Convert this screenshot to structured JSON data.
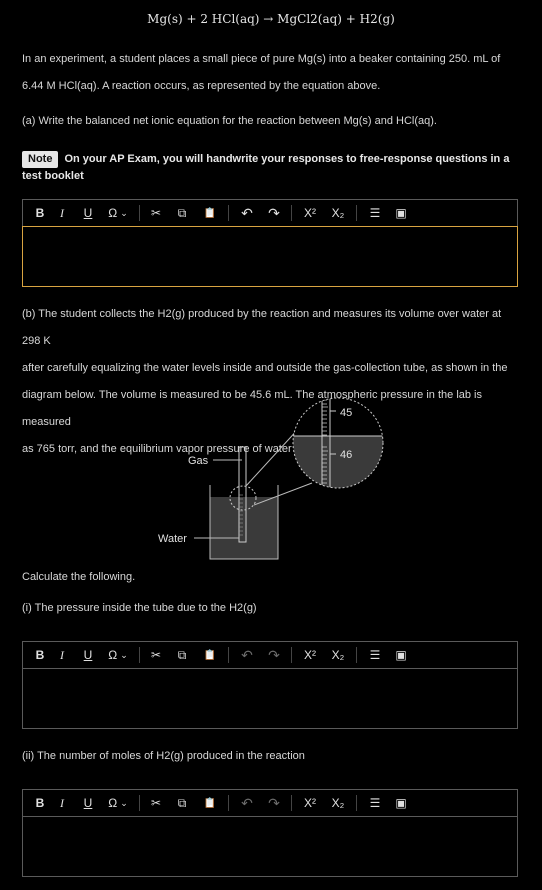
{
  "equation": "Mg(s) + 2 HCl(aq) → MgCl2(aq) + H2(g)",
  "intro_line1": "In an experiment, a student places a small piece of pure Mg(s) into a beaker containing 250. mL of",
  "intro_line2": "6.44 M HCl(aq). A reaction occurs, as represented by the equation above.",
  "part_a": "(a) Write the balanced net ionic equation for the reaction between Mg(s) and HCl(aq).",
  "note_badge": "Note",
  "note_text": "On your AP Exam, you will handwrite your responses to free-response questions in a test booklet",
  "part_b_line1": "(b) The student collects the H2(g) produced by the reaction and measures its volume over water at 298 K",
  "part_b_line2": "after carefully equalizing the water levels inside and outside the gas-collection tube, as shown in the",
  "part_b_line3": "diagram below. The volume is measured to be 45.6 mL. The atmospheric pressure in the lab is measured",
  "part_b_line4": "as 765 torr, and the equilibrium vapor pressure of water at 298 K is 24 torr.",
  "diagram": {
    "gas_label": "Gas",
    "water_label": "Water",
    "tick_45": "45",
    "tick_46": "46"
  },
  "calculate": "Calculate the following.",
  "part_i": "(i) The pressure inside the tube due to the H2(g)",
  "part_ii": "(ii) The number of moles of H2(g) produced in the reaction",
  "toolbar": {
    "bold": "B",
    "italic": "I",
    "underline": "U",
    "special": "Ω",
    "chevron": "⌄",
    "cut": "✂",
    "copy": "⧉",
    "paste": "📋",
    "undo": "↶",
    "redo": "↷",
    "superscript": "X²",
    "subscript": "X₂",
    "list": "☰",
    "image": "▣"
  },
  "colors": {
    "active_border": "#d9a441",
    "border": "#5a5a5a",
    "background": "#000000"
  }
}
